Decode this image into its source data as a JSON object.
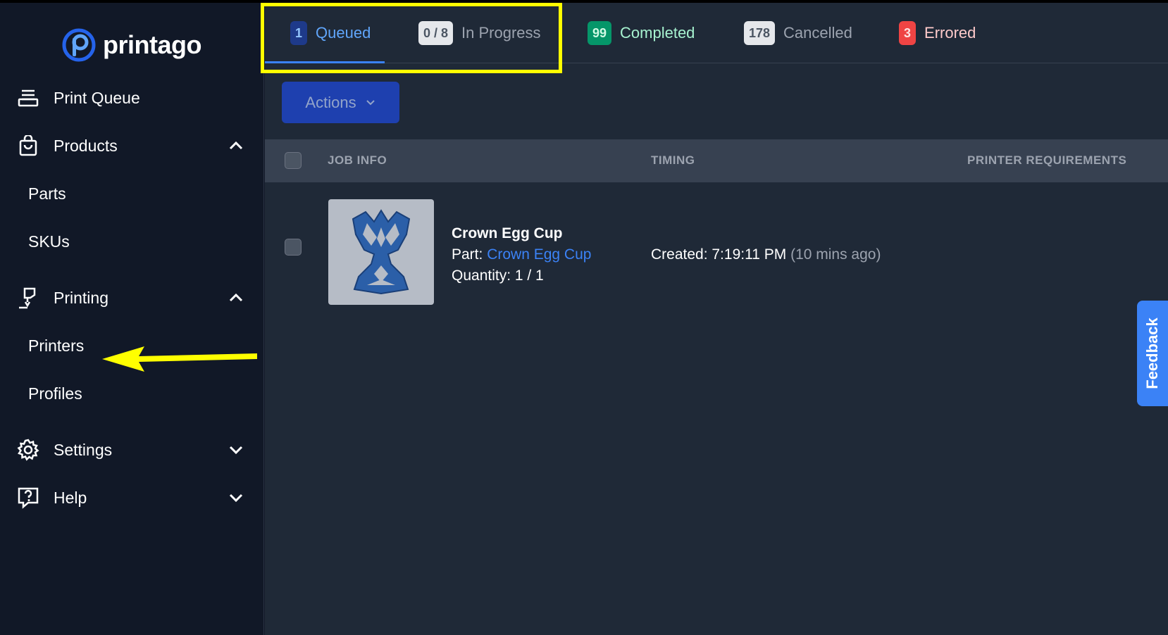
{
  "brand": {
    "name": "printago",
    "accent": "#3b82f6"
  },
  "sidebar": {
    "items": [
      {
        "label": "Print Queue",
        "icon": "print-queue-icon"
      },
      {
        "label": "Products",
        "icon": "shopping-bag-icon",
        "expanded": true,
        "children": [
          {
            "label": "Parts"
          },
          {
            "label": "SKUs"
          }
        ]
      },
      {
        "label": "Printing",
        "icon": "printer-arm-icon",
        "expanded": true,
        "children": [
          {
            "label": "Printers"
          },
          {
            "label": "Profiles"
          }
        ]
      },
      {
        "label": "Settings",
        "icon": "gear-icon",
        "expanded": false
      },
      {
        "label": "Help",
        "icon": "help-icon",
        "expanded": false
      }
    ]
  },
  "tabs": [
    {
      "badge": "1",
      "label": "Queued",
      "badge_bg": "#1e3a8a",
      "badge_color": "#93c5fd",
      "label_color": "#60a5fa",
      "active": true
    },
    {
      "badge": "0 / 8",
      "label": "In Progress",
      "badge_bg": "#e5e7eb",
      "badge_color": "#4b5563",
      "label_color": "#9ca3af",
      "active": false
    },
    {
      "badge": "99",
      "label": "Completed",
      "badge_bg": "#059669",
      "badge_color": "#d1fae5",
      "label_color": "#a7f3d0",
      "active": false
    },
    {
      "badge": "178",
      "label": "Cancelled",
      "badge_bg": "#e5e7eb",
      "badge_color": "#4b5563",
      "label_color": "#9ca3af",
      "active": false
    },
    {
      "badge": "3",
      "label": "Errored",
      "badge_bg": "#ef4444",
      "badge_color": "#fee2e2",
      "label_color": "#fecaca",
      "active": false
    }
  ],
  "toolbar": {
    "actions_label": "Actions"
  },
  "table": {
    "headers": {
      "job_info": "JOB INFO",
      "timing": "TIMING",
      "printer_requirements": "PRINTER REQUIREMENTS"
    },
    "rows": [
      {
        "title": "Crown Egg Cup",
        "part_label": "Part:",
        "part_link": "Crown Egg Cup",
        "quantity": "Quantity: 1 / 1",
        "created": "Created: 7:19:11 PM",
        "relative": "(10 mins ago)"
      }
    ]
  },
  "feedback_label": "Feedback",
  "annotations": {
    "highlight_color": "#ffff00"
  }
}
